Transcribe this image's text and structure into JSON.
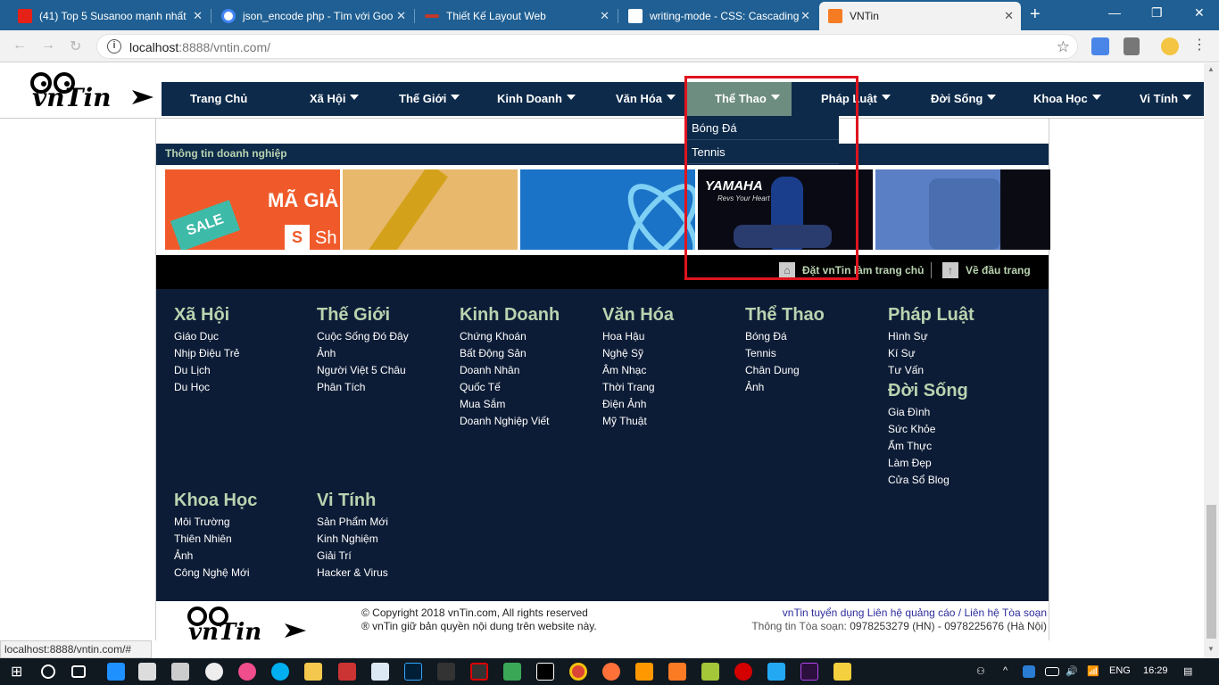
{
  "browser": {
    "tabs": [
      {
        "title": "(41) Top 5 Susanoo mạnh nhất",
        "favicon": "youtube-icon"
      },
      {
        "title": "json_encode php - Tìm với Goo",
        "favicon": "google-icon"
      },
      {
        "title": "Thiết Kế Layout Web",
        "favicon": "page-icon"
      },
      {
        "title": "writing-mode - CSS: Cascading",
        "favicon": "mdn-icon"
      },
      {
        "title": "VNTin",
        "favicon": "xampp-icon"
      }
    ],
    "url_host": "localhost",
    "url_rest": ":8888/vntin.com/",
    "status_url": "localhost:8888/vntin.com/#"
  },
  "site": {
    "logo_text": "vnTin",
    "nav": [
      {
        "label": "Trang Chủ",
        "has_caret": false
      },
      {
        "label": "Xã Hội",
        "has_caret": true
      },
      {
        "label": "Thế Giới",
        "has_caret": true
      },
      {
        "label": "Kinh Doanh",
        "has_caret": true
      },
      {
        "label": "Văn Hóa",
        "has_caret": true
      },
      {
        "label": "Thể Thao",
        "has_caret": true
      },
      {
        "label": "Pháp Luật",
        "has_caret": true
      },
      {
        "label": "Đời Sống",
        "has_caret": true
      },
      {
        "label": "Khoa Học",
        "has_caret": true
      },
      {
        "label": "Vi Tính",
        "has_caret": true
      }
    ],
    "dropdown": [
      "Bóng Đá",
      "Tennis"
    ],
    "biz_title": "Thông tin doanh nghiệp",
    "thumbs": [
      {
        "text": "MÃ GIẢ",
        "badge": "SALE",
        "brand": "Sh"
      },
      {
        "text": ""
      },
      {
        "text": ""
      },
      {
        "text": "YAMAHA",
        "sub": "Revs Your Heart"
      },
      {
        "text": ""
      }
    ],
    "tools": {
      "home": "Đặt vnTin làm trang chủ",
      "top": "Về đầu trang"
    },
    "footer_cols": [
      {
        "title": "Xã Hội",
        "links": [
          "Giáo Dục",
          "Nhịp Điệu Trẻ",
          "Du Lịch",
          "Du Học"
        ]
      },
      {
        "title": "Thế Giới",
        "links": [
          "Cuộc Sống Đó Đây",
          "Ảnh",
          "Người Việt 5 Châu",
          "Phân Tích"
        ]
      },
      {
        "title": "Kinh Doanh",
        "links": [
          "Chứng Khoán",
          "Bất Động Sản",
          "Doanh Nhân",
          "Quốc Tế",
          "Mua Sắm",
          "Doanh Nghiệp Viết"
        ]
      },
      {
        "title": "Văn Hóa",
        "links": [
          "Hoa Hậu",
          "Nghệ Sỹ",
          "Âm Nhạc",
          "Thời Trang",
          "Điện Ảnh",
          "Mỹ Thuật"
        ]
      },
      {
        "title": "Thể Thao",
        "links": [
          "Bóng Đá",
          "Tennis",
          "Chân Dung",
          "Ảnh"
        ]
      },
      {
        "title": "Pháp Luật",
        "links": [
          "Hình Sự",
          "Kí Sự",
          "Tư Vấn"
        ]
      },
      {
        "title": "Đời Sống",
        "links": [
          "Gia Đình",
          "Sức Khỏe",
          "Ẩm Thực",
          "Làm Đẹp",
          "Cửa Sổ Blog"
        ]
      },
      {
        "title": "Khoa Học",
        "links": [
          "Môi Trường",
          "Thiên Nhiên",
          "Ảnh",
          "Công Nghệ Mới"
        ]
      },
      {
        "title": "Vi Tính",
        "links": [
          "Sản Phẩm Mới",
          "Kinh Nghiệm",
          "Giải Trí",
          "Hacker & Virus"
        ]
      }
    ],
    "copyright": {
      "line1": "© Copyright 2018 vnTin.com, All rights reserved",
      "line2": "® vnTin giữ bản quyền nội dung trên website này.",
      "links": "vnTin tuyển dụng Liên hệ quảng cáo / Liên hệ Tòa soạn",
      "contact_label": "Thông tin Tòa soạn:",
      "contact_value": "0978253279 (HN) - 0978225676 (Hà Nội)"
    }
  },
  "taskbar": {
    "lang": "ENG",
    "time": "16:29"
  },
  "colors": {
    "nav_bg": "#0d2a4a",
    "accent_green": "#b9d3b0",
    "highlight": "#6d8d80",
    "annotation_red": "#e0141e"
  }
}
